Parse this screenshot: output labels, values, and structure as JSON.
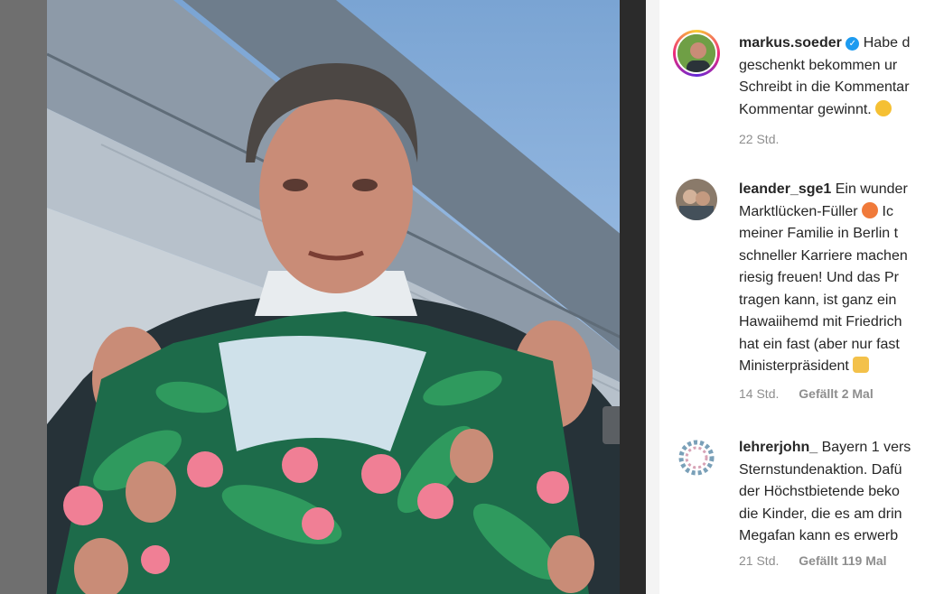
{
  "post": {
    "user": "markus.soeder",
    "verified_icon": "verified-badge-icon",
    "lines": [
      "Habe d",
      "geschenkt bekommen ur",
      "Schreibt in die Kommentar",
      "Kommentar gewinnt."
    ],
    "time": "22 Std."
  },
  "comments": [
    {
      "user": "leander_sge1",
      "lines": [
        "Ein wunder",
        "Marktlücken-Füller",
        "meiner Familie in Berlin t",
        "schneller Karriere machen",
        "riesig freuen! Und das Pr",
        "tragen kann, ist ganz ein",
        "Hawaiihemd mit Friedrich",
        "hat ein fast (aber nur fast",
        "Ministerpräsident"
      ],
      "line2_tail": "Ic",
      "time": "14 Std.",
      "likes": "Gefällt 2 Mal"
    },
    {
      "user": "lehrerjohn_",
      "lines": [
        "Bayern 1 vers",
        "Sternstundenaktion. Dafü",
        "der Höchstbietende beko",
        "die Kinder, die es am drin",
        "Megafan kann es erwerb"
      ],
      "time": "21 Std.",
      "likes": "Gefällt 119 Mal"
    }
  ],
  "colors": {
    "verified": "#1d9bf0",
    "meta": "#8e8e8e",
    "text": "#262626"
  }
}
